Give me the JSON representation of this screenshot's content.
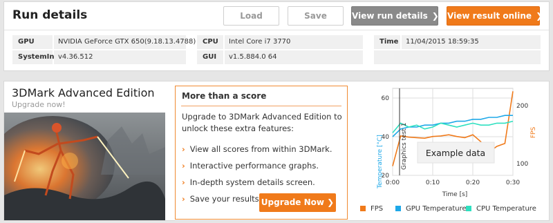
{
  "run_details": {
    "title": "Run details",
    "buttons": {
      "load": "Load",
      "save": "Save",
      "view_run": "View run details",
      "view_result": "View result online"
    },
    "info": {
      "gpu_label": "GPU",
      "gpu_value": "NVIDIA GeForce GTX 650(9.18.13.4788)",
      "systeminfo_label": "SystemInfo",
      "systeminfo_value": "v4.36.512",
      "cpu_label": "CPU",
      "cpu_value": "Intel Core i7 3770",
      "gui_label": "GUI",
      "gui_value": "v1.5.884.0 64",
      "time_label": "Time",
      "time_value": "11/04/2015 18:59:35"
    }
  },
  "edition": {
    "title": "3DMark Advanced Edition",
    "subtitle": "Upgrade now!"
  },
  "promo": {
    "heading": "More than a score",
    "text": "Upgrade to 3DMark Advanced Edition to unlock these extra features:",
    "features": [
      "View all scores from within 3DMark.",
      "Interactive performance graphs.",
      "In-depth system details screen.",
      "Save your results o"
    ],
    "upgrade_button": "Upgrade Now"
  },
  "chart_data": {
    "type": "line",
    "x": [
      0,
      2,
      4,
      6,
      8,
      10,
      12,
      14,
      16,
      18,
      20,
      22,
      24,
      26,
      28,
      30
    ],
    "xticks": [
      "0:00",
      "0:10",
      "0:20",
      "0:30"
    ],
    "xlabel": "Time [s]",
    "ylabel_left": "Temperature [°C]",
    "ylabel_right": "FPS",
    "left_ticks": [
      "20",
      "40",
      "60"
    ],
    "right_ticks": [
      "100",
      "200"
    ],
    "ylim_left": [
      20,
      65
    ],
    "ylim_right": [
      80,
      230
    ],
    "marker_label": "Graphics test 1",
    "overlay_label": "Example data",
    "series": [
      {
        "name": "FPS",
        "axis": "right",
        "color": "#f07a1a",
        "values": [
          96,
          148,
          146,
          145,
          144,
          147,
          148,
          150,
          147,
          145,
          150,
          138,
          120,
          130,
          135,
          225
        ]
      },
      {
        "name": "GPU Temperature",
        "axis": "left",
        "color": "#1ea8e8",
        "values": [
          40,
          44,
          45,
          45,
          46,
          46,
          47,
          47,
          48,
          48,
          49,
          49,
          50,
          50,
          51,
          51
        ]
      },
      {
        "name": "CPU Temperature",
        "axis": "left",
        "color": "#2ee0c0",
        "values": [
          42,
          47,
          45,
          46,
          44,
          45,
          47,
          46,
          45,
          46,
          47,
          46,
          46,
          47,
          47,
          48
        ]
      }
    ],
    "colors": {
      "axis_left": "#1ea8e8",
      "axis_right": "#f07a1a",
      "grid": "#dddddd"
    }
  }
}
